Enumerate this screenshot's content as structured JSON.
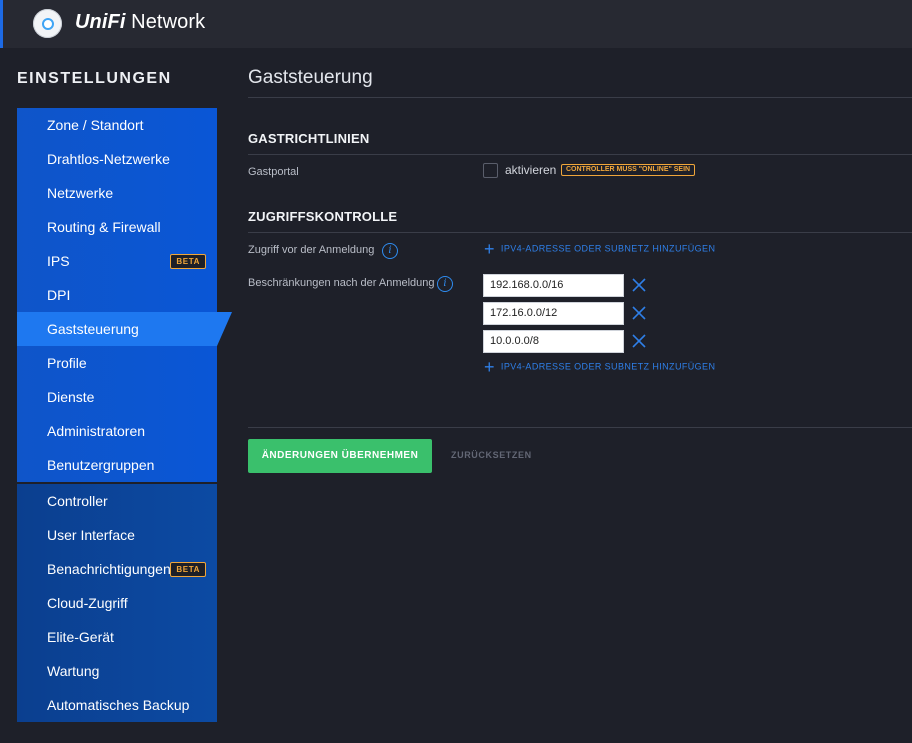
{
  "app": {
    "brand_prefix": "UniFi",
    "brand_suffix": " Network"
  },
  "sidebar": {
    "title": "EINSTELLUNGEN",
    "group1": [
      {
        "label": "Zone / Standort"
      },
      {
        "label": "Drahtlos-Netzwerke"
      },
      {
        "label": "Netzwerke"
      },
      {
        "label": "Routing & Firewall"
      },
      {
        "label": "IPS",
        "badge": "BETA"
      },
      {
        "label": "DPI"
      },
      {
        "label": "Gaststeuerung",
        "active": true
      },
      {
        "label": "Profile"
      },
      {
        "label": "Dienste"
      },
      {
        "label": "Administratoren"
      },
      {
        "label": "Benutzergruppen"
      }
    ],
    "group2": [
      {
        "label": "Controller"
      },
      {
        "label": "User Interface"
      },
      {
        "label": "Benachrichtigungen",
        "badge": "BETA"
      },
      {
        "label": "Cloud-Zugriff"
      },
      {
        "label": "Elite-Gerät"
      },
      {
        "label": "Wartung"
      },
      {
        "label": "Automatisches Backup"
      }
    ]
  },
  "main": {
    "title": "Gaststeuerung",
    "guest_policies": {
      "title": "GASTRICHTLINIEN",
      "portal_label": "Gastportal",
      "enable_label": "aktivieren",
      "enabled": false,
      "warning_badge": "CONTROLLER MUSS \"ONLINE\" SEIN"
    },
    "access_control": {
      "title": "ZUGRIFFSKONTROLLE",
      "pre_auth_label": "Zugriff vor der Anmeldung",
      "post_auth_label": "Beschränkungen nach der Anmeldung",
      "add_label": "IPV4-ADRESSE ODER SUBNETZ HINZUFÜGEN",
      "post_auth_restrictions": [
        "192.168.0.0/16",
        "172.16.0.0/12",
        "10.0.0.0/8"
      ]
    },
    "actions": {
      "apply_label": "ÄNDERUNGEN ÜBERNEHMEN",
      "reset_label": "ZURÜCKSETZEN"
    }
  },
  "colors": {
    "accent": "#1e78f0",
    "apply_green": "#3ac06c",
    "warning": "#f0a63a",
    "link": "#2f7fe8"
  }
}
